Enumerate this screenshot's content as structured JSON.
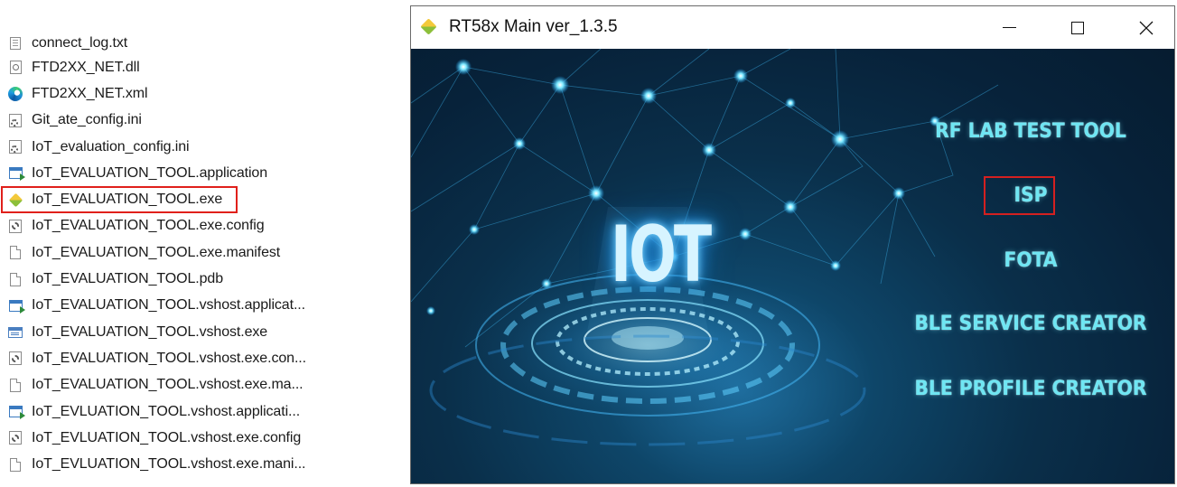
{
  "file_list": {
    "items": [
      {
        "label": "connect_log.txt",
        "icon": "text-file-icon"
      },
      {
        "label": "FTD2XX_NET.dll",
        "icon": "dll-file-icon"
      },
      {
        "label": "FTD2XX_NET.xml",
        "icon": "edge-browser-icon"
      },
      {
        "label": "Git_ate_config.ini",
        "icon": "ini-file-icon"
      },
      {
        "label": "IoT_evaluation_config.ini",
        "icon": "ini-file-icon"
      },
      {
        "label": "IoT_EVALUATION_TOOL.application",
        "icon": "application-manifest-icon"
      },
      {
        "label": "IoT_EVALUATION_TOOL.exe",
        "icon": "rt58x-app-icon"
      },
      {
        "label": "IoT_EVALUATION_TOOL.exe.config",
        "icon": "config-file-icon"
      },
      {
        "label": "IoT_EVALUATION_TOOL.exe.manifest",
        "icon": "blank-file-icon"
      },
      {
        "label": "IoT_EVALUATION_TOOL.pdb",
        "icon": "blank-file-icon"
      },
      {
        "label": "IoT_EVALUATION_TOOL.vshost.applicat...",
        "icon": "application-manifest-icon"
      },
      {
        "label": "IoT_EVALUATION_TOOL.vshost.exe",
        "icon": "executable-icon"
      },
      {
        "label": "IoT_EVALUATION_TOOL.vshost.exe.con...",
        "icon": "config-file-icon"
      },
      {
        "label": "IoT_EVALUATION_TOOL.vshost.exe.ma...",
        "icon": "blank-file-icon"
      },
      {
        "label": "IoT_EVLUATION_TOOL.vshost.applicati...",
        "icon": "application-manifest-icon"
      },
      {
        "label": "IoT_EVLUATION_TOOL.vshost.exe.config",
        "icon": "config-file-icon"
      },
      {
        "label": "IoT_EVLUATION_TOOL.vshost.exe.mani...",
        "icon": "blank-file-icon"
      }
    ],
    "highlighted_item": "IoT_EVALUATION_TOOL.exe",
    "highlight_color": "#e0201b"
  },
  "window": {
    "title": "RT58x Main ver_1.3.5",
    "icon": "rt58x-app-icon",
    "controls": {
      "minimize": "minimize-icon",
      "maximize": "maximize-icon",
      "close": "close-icon"
    }
  },
  "main": {
    "banner_text": "IOT",
    "menu": {
      "rf_lab": "RF LAB TEST TOOL",
      "isp": "ISP",
      "fota": "FOTA",
      "ble_service": "BLE SERVICE CREATOR",
      "ble_profile": "BLE PROFILE CREATOR"
    },
    "highlighted_menu": "ISP",
    "colors": {
      "menu_text": "#6fe6f3",
      "background": "#07223a",
      "highlight": "#d42020"
    }
  }
}
